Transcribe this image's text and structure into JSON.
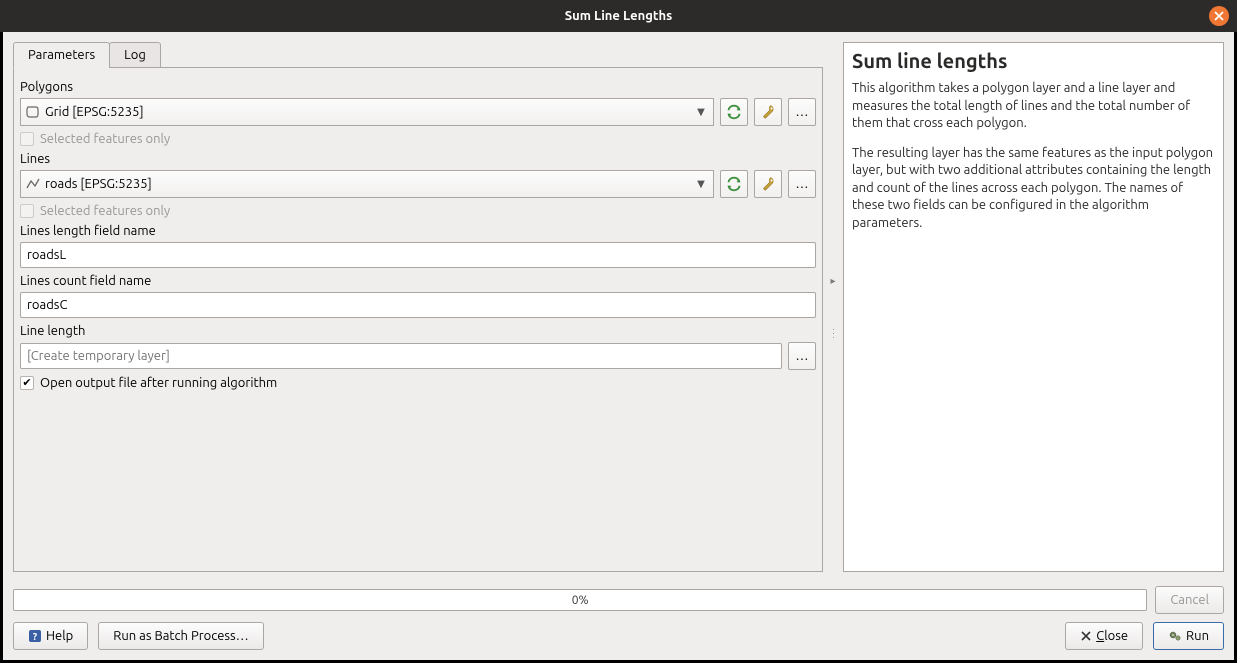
{
  "window": {
    "title": "Sum Line Lengths"
  },
  "tabs": {
    "parameters": "Parameters",
    "log": "Log"
  },
  "form": {
    "polygons_label": "Polygons",
    "polygons_value": "Grid [EPSG:5235]",
    "polygons_selected_only": "Selected features only",
    "lines_label": "Lines",
    "lines_value": "roads [EPSG:5235]",
    "lines_selected_only": "Selected features only",
    "length_field_label": "Lines length field name",
    "length_field_value": "roadsL",
    "count_field_label": "Lines count field name",
    "count_field_value": "roadsC",
    "output_label": "Line length",
    "output_placeholder": "[Create temporary layer]",
    "open_after": "Open output file after running algorithm"
  },
  "help": {
    "title": "Sum line lengths",
    "p1": "This algorithm takes a polygon layer and a line layer and measures the total length of lines and the total number of them that cross each polygon.",
    "p2": "The resulting layer has the same features as the input polygon layer, but with two additional attributes containing the length and count of the lines across each polygon. The names of these two fields can be configured in the algorithm parameters."
  },
  "footer": {
    "progress": "0%",
    "cancel": "Cancel",
    "help": "Help",
    "batch": "Run as Batch Process…",
    "close": "Close",
    "run": "Run"
  }
}
